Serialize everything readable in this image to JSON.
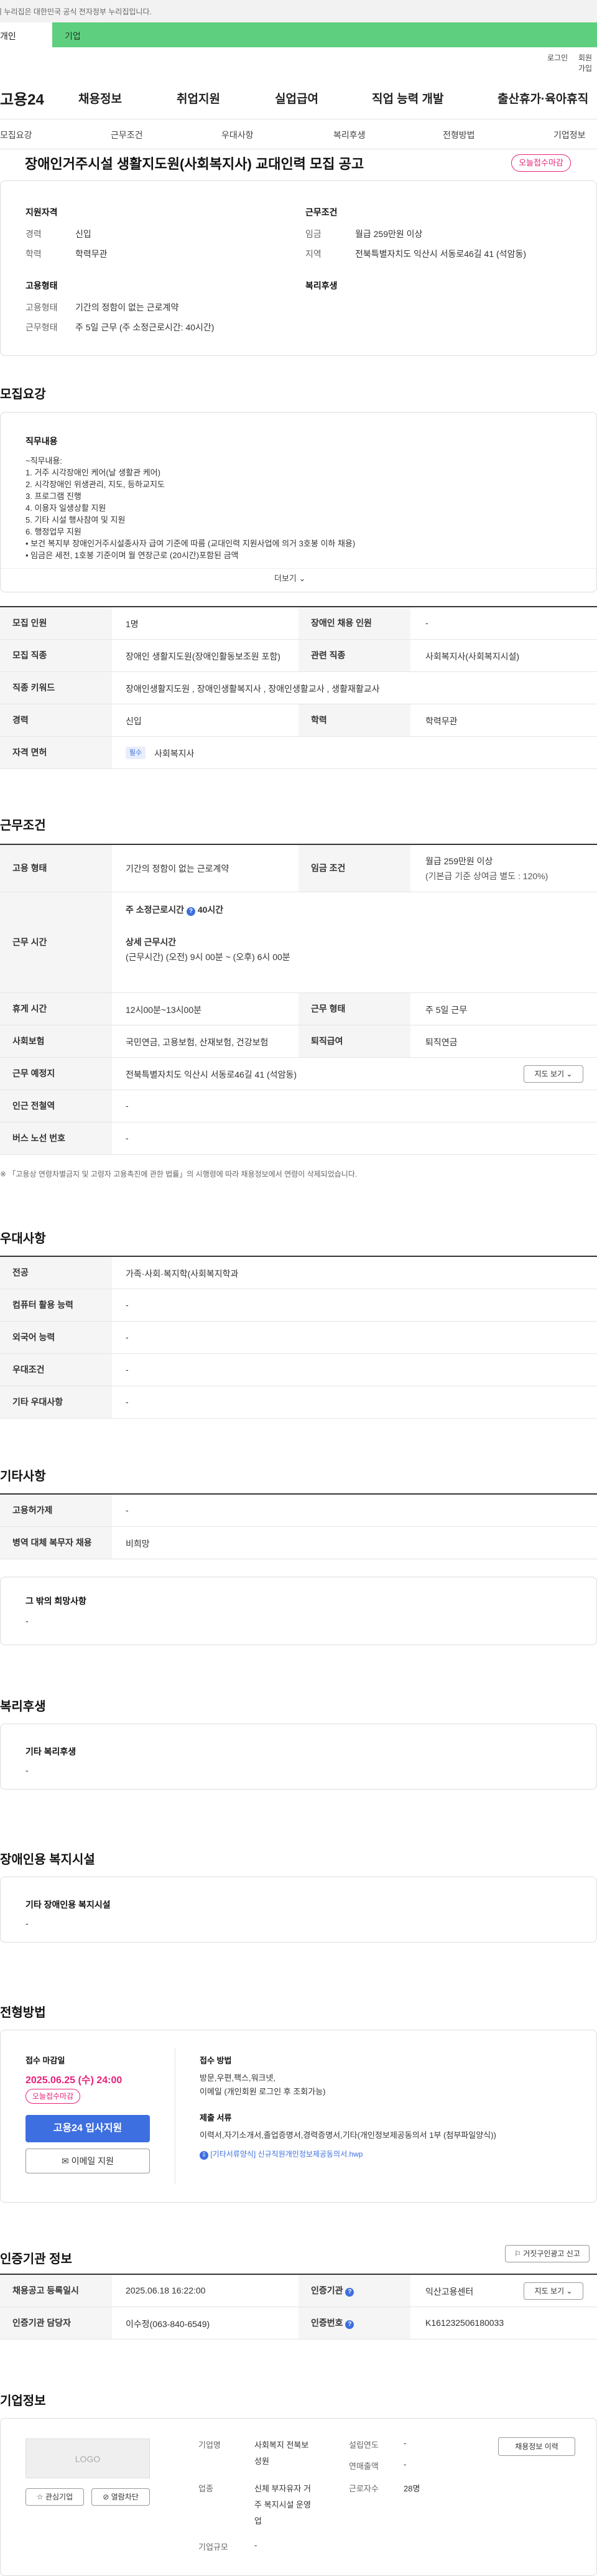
{
  "gov_banner": "이 누리집은 대한민국 공식 전자정부 누리집입니다.",
  "top_tabs": {
    "personal": "개인",
    "corporate": "기업"
  },
  "util_links": {
    "login": "로그인",
    "signup": "회원가입"
  },
  "gnb": {
    "logo": "고용24",
    "menu": [
      "채용정보",
      "취업지원",
      "실업급여",
      "직업 능력 개발",
      "출산휴가·육아휴직"
    ]
  },
  "subnav": [
    "모집요강",
    "근무조건",
    "우대사항",
    "복리후생",
    "전형방법",
    "기업정보"
  ],
  "title": "장애인거주시설 생활지도원(사회복지사) 교대인력 모집 공고",
  "dday_badge": "오늘접수마감",
  "summary": {
    "qualification_title": "지원자격",
    "career_label": "경력",
    "career_value": "신입",
    "education_label": "학력",
    "education_value": "학력무관",
    "work_title": "근무조건",
    "wage_label": "임금",
    "wage_value": "월급 259만원 이상",
    "region_label": "지역",
    "region_value": "전북특별자치도 익산시 서동로46길 41 (석암동)",
    "employment_title": "고용형태",
    "emptype_label": "고용형태",
    "emptype_value": "기간의 정함이 없는 근로계약",
    "worktype_label": "근무형태",
    "worktype_value": "주 5일 근무 (주 소정근로시간: 40시간)",
    "welfare_title": "복리후생"
  },
  "recruit": {
    "section_title": "모집요강",
    "job_title": "직무내용",
    "job_lines": [
      "~직무내용:",
      "1. 거주 시각장애인 케어(날 생활관 케어)",
      "2. 시각장애인 위생관리, 지도, 등하교지도",
      "3. 프로그램  진행",
      "4. 이용자 일생상활 지원",
      "5. 기타 시설 행사참여 및 지원",
      "6. 행정업무 지원",
      "• 보건 복지부 장애인거주시설종사자 급여 기준에 따름 (교대인력 지원사업에 의거 3호봉 이하 채용)",
      "• 임금은 세전, 1호봉 기준이며 월 연장근로 (20시간)포함된 금액"
    ],
    "more": "더보기",
    "rows": [
      {
        "th": "모집 인원",
        "td": "1명",
        "th2": "장애인 채용 인원",
        "td2": "-"
      },
      {
        "th": "모집 직종",
        "td": "장애인 생활지도원(장애인활동보조원 포함)",
        "th2": "관련 직종",
        "td2": "사회복지사(사회복지시설)"
      },
      {
        "th": "직종 키워드",
        "td": "장애인생활지도원 , 장애인생활복지사 , 장애인생활교사 , 생활재활교사"
      },
      {
        "th": "경력",
        "td": "신입",
        "th2": "학력",
        "td2": "학력무관"
      },
      {
        "th": "자격 면허",
        "chip": "필수",
        "td": "사회복지사"
      }
    ]
  },
  "conditions": {
    "section_title": "근무조건",
    "emp_type_th": "고용 형태",
    "emp_type_td": "기간의 정함이 없는 근로계약",
    "wage_th": "임금 조건",
    "wage_td1": "월급 259만원 이상",
    "wage_td2": "(기본급 기준 상여금 별도 : 120%)",
    "hours_th": "근무 시간",
    "hours_weekly": "주 소정근로시간",
    "hours_weekly_val": "40시간",
    "hours_detail_title": "상세 근무시간",
    "hours_detail": "(근무시간) (오전) 9시 00분 ~ (오후) 6시 00분",
    "break_th": "휴게 시간",
    "break_td": "12시00분~13시00분",
    "worktype_th": "근무 형태",
    "worktype_td": "주 5일 근무",
    "insurance_th": "사회보험",
    "insurance_td": "국민연금, 고용보험, 산재보험, 건강보험",
    "retire_th": "퇴직급여",
    "retire_td": "퇴직연금",
    "place_th": "근무 예정지",
    "place_td": "전북특별자치도 익산시 서동로46길 41 (석암동)",
    "map_btn": "지도 보기",
    "subway_th": "인근 전철역",
    "subway_td": "-",
    "bus_th": "버스 노선 번호",
    "bus_td": "-",
    "note": "※ 「고용상 연령차별금지 및 고령자 고용촉진에 관한 법률」의 시행령에 따라 채용정보에서 연령이 삭제되었습니다."
  },
  "preference": {
    "section_title": "우대사항",
    "rows": [
      {
        "th": "전공",
        "td": "가족·사회·복지학(사회복지학과"
      },
      {
        "th": "컴퓨터 활용 능력",
        "td": "-"
      },
      {
        "th": "외국어 능력",
        "td": "-"
      },
      {
        "th": "우대조건",
        "td": "-"
      },
      {
        "th": "기타 우대사항",
        "td": "-"
      }
    ]
  },
  "etc": {
    "section_title": "기타사항",
    "rows": [
      {
        "th": "고용허가제",
        "td": "-"
      },
      {
        "th": "병역 대체 복무자 채용",
        "td": "비희망"
      }
    ],
    "other_title": "그 밖의 희망사항",
    "other_value": "-"
  },
  "welfare": {
    "section_title": "복리후생",
    "box_title": "기타 복리후생",
    "box_value": "-"
  },
  "disabled": {
    "section_title": "장애인용 복지시설",
    "box_title": "기타 장애인용 복지시설",
    "box_value": "-"
  },
  "selection": {
    "section_title": "전형방법",
    "deadline_title": "접수 마감일",
    "deadline_value": "2025.06.25 (수) 24:00",
    "deadline_badge": "오늘접수마감",
    "apply_btn": "고용24 입사지원",
    "email_btn": "이메일 지원",
    "method_title": "접수 방법",
    "method_lines": [
      "방문,우편,팩스,워크넷,",
      "이메일 (개인회원 로그인 후 조회가능)"
    ],
    "docs_title": "제출 서류",
    "docs_value": "이력서,자기소개서,졸업증명서,경력증명서,기타(개인정보제공동의서 1부 (첨부파일양식))",
    "attach_link": "[기타서류양식] 신규직원개인정보제공동의서.hwp"
  },
  "agency": {
    "section_title": "인증기관 정보",
    "report_btn": "거짓구인광고 신고",
    "reg_date_th": "채용공고 등록일시",
    "reg_date_td": "2025.06.18 16:22:00",
    "agency_th": "인증기관",
    "agency_td": "익산고용센터",
    "map_btn": "지도 보기",
    "manager_th": "인증기관 담당자",
    "manager_td": "이수정(063-840-6549)",
    "cert_th": "인증번호",
    "cert_td": "K161232506180033"
  },
  "company": {
    "section_title": "기업정보",
    "logo_text": "LOGO",
    "fav_btn": "관심기업",
    "block_btn": "열람차단",
    "recruit_btn": "채용정보 이력",
    "name_label": "기업명",
    "name_value_1": "사회복지 전북보",
    "name_value_2": "성원",
    "industry_label": "업종",
    "industry_value_1": "신체 부자유자 거",
    "industry_value_2": "주 복지시설 운영",
    "industry_value_3": "업",
    "size_label": "기업규모",
    "size_value": "-",
    "founded_label": "설립연도",
    "founded_value": "-",
    "revenue_label": "연매출액",
    "revenue_value": "-",
    "employees_label": "근로자수",
    "employees_value": "28명"
  }
}
